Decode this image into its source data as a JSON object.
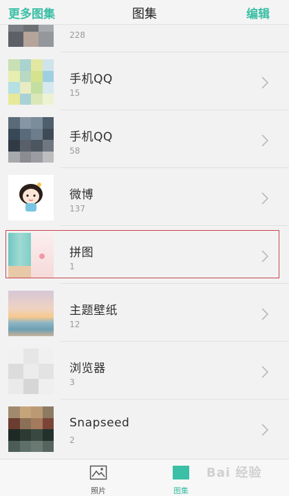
{
  "header": {
    "left_action": "更多图集",
    "title": "图集",
    "right_action": "编辑"
  },
  "albums": [
    {
      "name": "",
      "count": "228"
    },
    {
      "name": "手机QQ",
      "count": "15"
    },
    {
      "name": "手机QQ",
      "count": "58"
    },
    {
      "name": "微博",
      "count": "137"
    },
    {
      "name": "拼图",
      "count": "1"
    },
    {
      "name": "主题壁纸",
      "count": "12"
    },
    {
      "name": "浏览器",
      "count": "3"
    },
    {
      "name": "Snapseed",
      "count": "2"
    }
  ],
  "tabs": [
    {
      "label": "照片",
      "icon": "photo-icon",
      "active": false
    },
    {
      "label": "图集",
      "icon": "album-icon",
      "active": true
    }
  ],
  "colors": {
    "accent": "#3bbfa6",
    "highlight_border": "#c9434d"
  },
  "watermark": "Bai 经验"
}
